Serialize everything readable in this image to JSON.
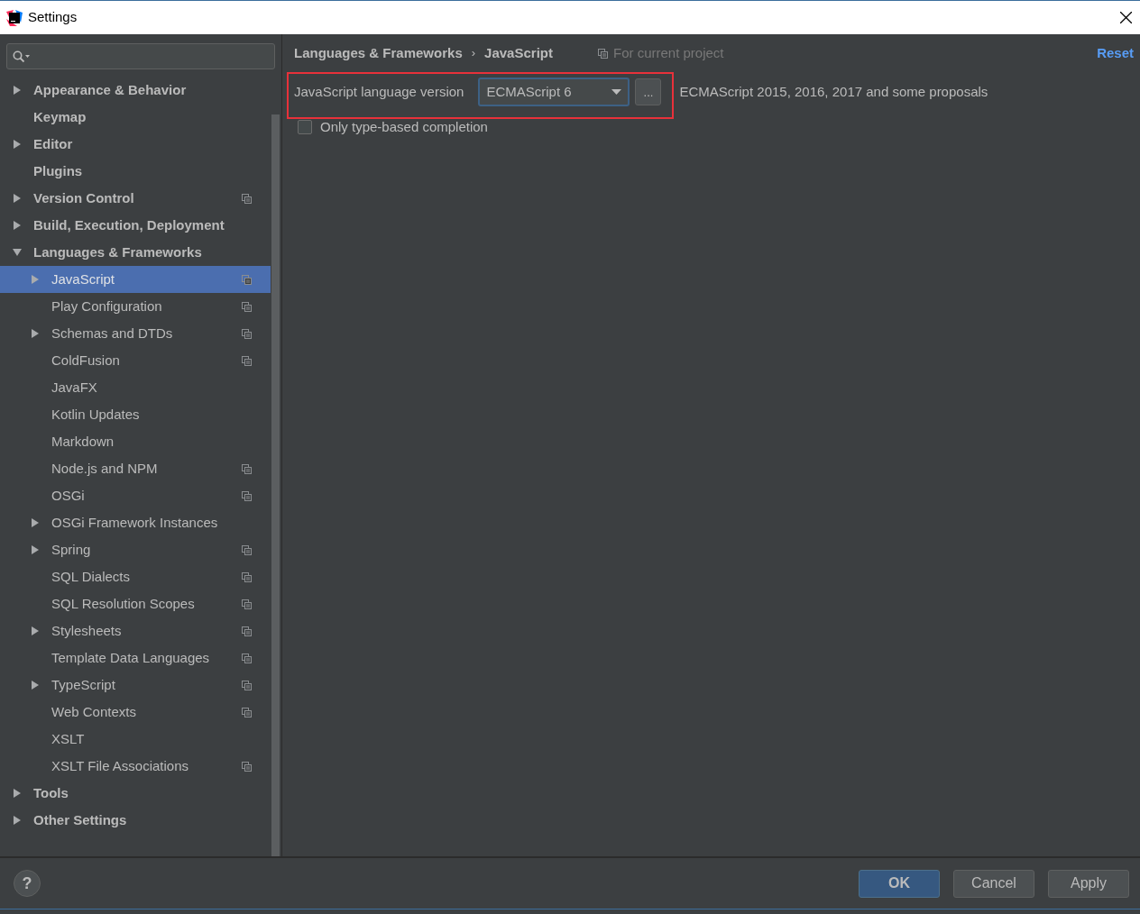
{
  "window": {
    "title": "Settings"
  },
  "tree": [
    {
      "label": "Appearance & Behavior",
      "expandable": true,
      "expanded": false,
      "project_scoped": false,
      "selected": false
    },
    {
      "label": "Keymap",
      "expandable": false,
      "project_scoped": false,
      "selected": false
    },
    {
      "label": "Editor",
      "expandable": true,
      "expanded": false,
      "project_scoped": false,
      "selected": false
    },
    {
      "label": "Plugins",
      "expandable": false,
      "project_scoped": false,
      "selected": false
    },
    {
      "label": "Version Control",
      "expandable": true,
      "expanded": false,
      "project_scoped": true,
      "selected": false
    },
    {
      "label": "Build, Execution, Deployment",
      "expandable": true,
      "expanded": false,
      "project_scoped": false,
      "selected": false
    },
    {
      "label": "Languages & Frameworks",
      "expandable": true,
      "expanded": true,
      "project_scoped": false,
      "selected": false,
      "children": [
        {
          "label": "JavaScript",
          "expandable": true,
          "expanded": false,
          "project_scoped": true,
          "selected": true
        },
        {
          "label": "Play Configuration",
          "expandable": false,
          "project_scoped": true,
          "selected": false
        },
        {
          "label": "Schemas and DTDs",
          "expandable": true,
          "expanded": false,
          "project_scoped": true,
          "selected": false
        },
        {
          "label": "ColdFusion",
          "expandable": false,
          "project_scoped": true,
          "selected": false
        },
        {
          "label": "JavaFX",
          "expandable": false,
          "project_scoped": false,
          "selected": false
        },
        {
          "label": "Kotlin Updates",
          "expandable": false,
          "project_scoped": false,
          "selected": false
        },
        {
          "label": "Markdown",
          "expandable": false,
          "project_scoped": false,
          "selected": false
        },
        {
          "label": "Node.js and NPM",
          "expandable": false,
          "project_scoped": true,
          "selected": false
        },
        {
          "label": "OSGi",
          "expandable": false,
          "project_scoped": true,
          "selected": false
        },
        {
          "label": "OSGi Framework Instances",
          "expandable": true,
          "expanded": false,
          "project_scoped": false,
          "selected": false
        },
        {
          "label": "Spring",
          "expandable": true,
          "expanded": false,
          "project_scoped": true,
          "selected": false
        },
        {
          "label": "SQL Dialects",
          "expandable": false,
          "project_scoped": true,
          "selected": false
        },
        {
          "label": "SQL Resolution Scopes",
          "expandable": false,
          "project_scoped": true,
          "selected": false
        },
        {
          "label": "Stylesheets",
          "expandable": true,
          "expanded": false,
          "project_scoped": true,
          "selected": false
        },
        {
          "label": "Template Data Languages",
          "expandable": false,
          "project_scoped": true,
          "selected": false
        },
        {
          "label": "TypeScript",
          "expandable": true,
          "expanded": false,
          "project_scoped": true,
          "selected": false
        },
        {
          "label": "Web Contexts",
          "expandable": false,
          "project_scoped": true,
          "selected": false
        },
        {
          "label": "XSLT",
          "expandable": false,
          "project_scoped": false,
          "selected": false
        },
        {
          "label": "XSLT File Associations",
          "expandable": false,
          "project_scoped": true,
          "selected": false
        }
      ]
    },
    {
      "label": "Tools",
      "expandable": true,
      "expanded": false,
      "project_scoped": false,
      "selected": false
    },
    {
      "label": "Other Settings",
      "expandable": true,
      "expanded": false,
      "project_scoped": false,
      "selected": false
    }
  ],
  "breadcrumb": {
    "parent": "Languages & Frameworks",
    "separator": "›",
    "current": "JavaScript",
    "scope": "For current project",
    "reset": "Reset"
  },
  "language_version": {
    "label": "JavaScript language version",
    "value": "ECMAScript 6",
    "more": "...",
    "description": "ECMAScript 2015, 2016, 2017 and some proposals"
  },
  "options": [
    {
      "label": "Only type-based completion",
      "checked": false
    }
  ],
  "buttons": [
    {
      "label": "OK",
      "default": true
    },
    {
      "label": "Cancel",
      "default": false
    },
    {
      "label": "Apply",
      "default": false
    }
  ],
  "help": "?"
}
